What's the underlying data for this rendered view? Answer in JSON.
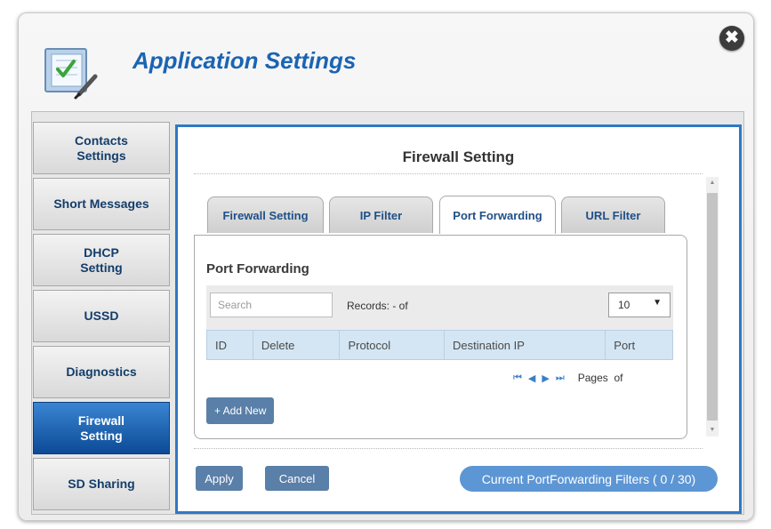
{
  "header": {
    "title": "Application Settings",
    "close_symbol": "✖",
    "icon": "settings-checklist-icon"
  },
  "sidebar": {
    "items": [
      {
        "label": "Contacts\nSettings",
        "active": false
      },
      {
        "label": "Short Messages",
        "active": false
      },
      {
        "label": "DHCP\nSetting",
        "active": false
      },
      {
        "label": "USSD",
        "active": false
      },
      {
        "label": "Diagnostics",
        "active": false
      },
      {
        "label": "Firewall\nSetting",
        "active": true
      },
      {
        "label": "SD Sharing",
        "active": false
      }
    ]
  },
  "main": {
    "title": "Firewall Setting",
    "tabs": [
      {
        "label": "Firewall Setting",
        "active": false
      },
      {
        "label": "IP Filter",
        "active": false
      },
      {
        "label": "Port Forwarding",
        "active": true
      },
      {
        "label": "URL Filter",
        "active": false
      }
    ],
    "panel": {
      "title": "Port Forwarding",
      "search_placeholder": "Search",
      "records_text": "Records: - of",
      "page_size": "10",
      "page_size_arrow": "▼",
      "columns": [
        "ID",
        "Delete",
        "Protocol",
        "Destination IP",
        "Port"
      ],
      "pager": {
        "first": "⏮",
        "prev": "◀",
        "next": "▶",
        "last": "⏭",
        "pages_text": "Pages  of"
      },
      "add_new_label": "+ Add New"
    },
    "footer": {
      "apply_label": "Apply",
      "cancel_label": "Cancel",
      "summary": "Current PortForwarding Filters ( 0 / 30)"
    }
  },
  "colors": {
    "accent": "#2f79c6",
    "title": "#1a64b4",
    "button": "#5a7fa8",
    "pill": "#5d96d4",
    "active_sidebar": "#0c4a96",
    "table_header": "#d4e6f4"
  }
}
